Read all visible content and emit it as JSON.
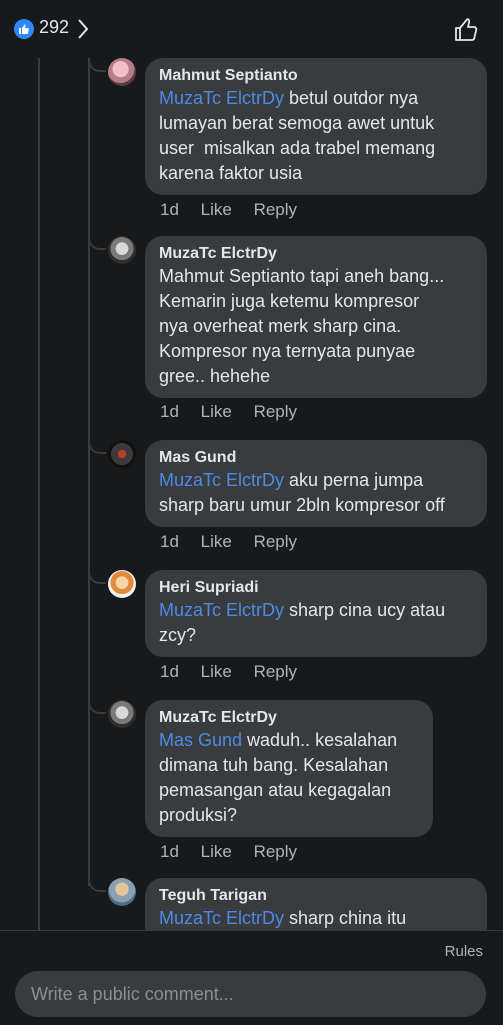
{
  "header": {
    "like_count": "292"
  },
  "comments": [
    {
      "author": "Mahmut Septianto",
      "mention": "MuzaTc ElctrDy",
      "text": " betul outdor nya\nlumayan berat semoga awet untuk\nuser  misalkan ada trabel memang\nkarena faktor usia",
      "time": "1d",
      "like": "Like",
      "reply": "Reply"
    },
    {
      "author": "MuzaTc ElctrDy",
      "mention": "",
      "text": "Mahmut Septianto tapi aneh bang...\nKemarin juga ketemu kompresor\nnya overheat merk sharp cina.\nKompresor nya ternyata punyae\ngree.. hehehe",
      "time": "1d",
      "like": "Like",
      "reply": "Reply"
    },
    {
      "author": "Mas Gund",
      "mention": "MuzaTc ElctrDy",
      "text": " aku perna jumpa\nsharp baru umur 2bln kompresor off",
      "time": "1d",
      "like": "Like",
      "reply": "Reply"
    },
    {
      "author": "Heri Supriadi",
      "mention": "MuzaTc ElctrDy",
      "text": " sharp cina ucy atau\nzcy?",
      "time": "1d",
      "like": "Like",
      "reply": "Reply"
    },
    {
      "author": "MuzaTc ElctrDy",
      "mention": "Mas Gund",
      "text": " waduh.. kesalahan\ndimana tuh bang. Kesalahan\npemasangan atau kegagalan\nproduksi?",
      "time": "1d",
      "like": "Like",
      "reply": "Reply"
    },
    {
      "author": "Teguh Tarigan",
      "mention": "MuzaTc ElctrDy",
      "text": " sharp china itu",
      "time": "",
      "like": "",
      "reply": ""
    }
  ],
  "footer": {
    "rules": "Rules",
    "placeholder": "Write a public comment..."
  }
}
